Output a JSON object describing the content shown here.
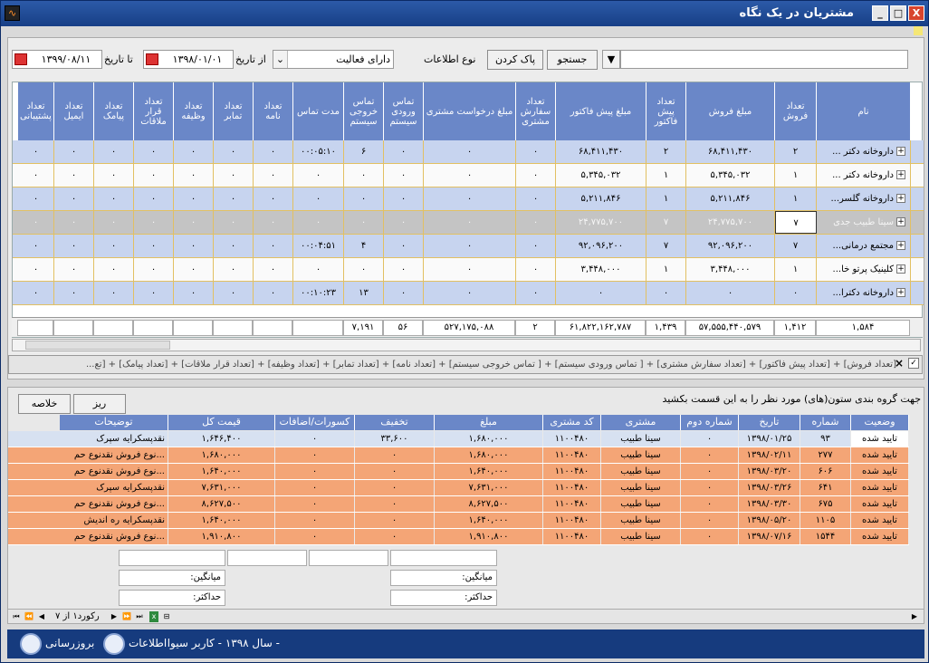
{
  "window": {
    "title": "مشتریان در یک نگاه",
    "min": "_",
    "max": "□",
    "close": "X"
  },
  "toolbar": {
    "search_btn": "جستجو",
    "clear_btn": "پاک کردن",
    "info_type_label": "نوع اطلاعات",
    "info_type_value": "دارای فعالیت",
    "from_label": "از تاریخ",
    "from_value": "۱۳۹۸/۰۱/۰۱",
    "to_label": "تا تاریخ",
    "to_value": "۱۳۹۹/۰۸/۱۱"
  },
  "grid": {
    "headers": [
      "نام",
      "تعداد فروش",
      "مبلغ فروش",
      "تعداد پیش فاکتور",
      "مبلغ پیش فاکتور",
      "تعداد سفارش مشتری",
      "مبلغ درخواست مشتری",
      "تماس ورودی سیستم",
      "تماس خروجی سیستم",
      "مدت تماس",
      "تعداد نامه",
      "تعداد تمابر",
      "تعداد وظیفه",
      "تعداد قرار ملاقات",
      "تعداد پیامک",
      "تعداد ایمیل",
      "تعداد پشتیبانی"
    ],
    "rows": [
      [
        "داروخانه دکتر ...",
        "۲",
        "۶۸,۴۱۱,۴۳۰",
        "۲",
        "۶۸,۴۱۱,۴۳۰",
        "۰",
        "۰",
        "۰",
        "۶",
        "۰۰:۰۵:۱۰",
        "۰",
        "۰",
        "۰",
        "۰",
        "۰",
        "۰",
        "۰"
      ],
      [
        "داروخانه دکتر ...",
        "۱",
        "۵,۳۴۵,۰۳۲",
        "۱",
        "۵,۳۴۵,۰۳۲",
        "۰",
        "۰",
        "۰",
        "۰",
        "۰",
        "۰",
        "۰",
        "۰",
        "۰",
        "۰",
        "۰",
        "۰"
      ],
      [
        "داروخانه گلسر...",
        "۱",
        "۵,۲۱۱,۸۴۶",
        "۱",
        "۵,۲۱۱,۸۴۶",
        "۰",
        "۰",
        "۰",
        "۰",
        "۰",
        "۰",
        "۰",
        "۰",
        "۰",
        "۰",
        "۰",
        "۰"
      ],
      [
        "سینا طبیب جدی",
        "۷",
        "۲۴,۷۷۵,۷۰۰",
        "۷",
        "۲۴,۷۷۵,۷۰۰",
        "۰",
        "۰",
        "۰",
        "۰",
        "۰",
        "۰",
        "۰",
        "۰",
        "۰",
        "۰",
        "۰",
        "۰"
      ],
      [
        "مجتمع درمانی...",
        "۷",
        "۹۲,۰۹۶,۲۰۰",
        "۷",
        "۹۲,۰۹۶,۲۰۰",
        "۰",
        "۰",
        "۰",
        "۴",
        "۰۰:۰۴:۵۱",
        "۰",
        "۰",
        "۰",
        "۰",
        "۰",
        "۰",
        "۰"
      ],
      [
        "کلینیک پرتو خا...",
        "۱",
        "۳,۴۴۸,۰۰۰",
        "۱",
        "۳,۴۴۸,۰۰۰",
        "۰",
        "۰",
        "۰",
        "۰",
        "۰",
        "۰",
        "۰",
        "۰",
        "۰",
        "۰",
        "۰",
        "۰"
      ],
      [
        "داروخانه دکترا...",
        "۰",
        "۰",
        "۰",
        "۰",
        "۰",
        "۰",
        "۰",
        "۱۳",
        "۰۰:۱۰:۲۳",
        "۰",
        "۰",
        "۰",
        "۰",
        "۰",
        "۰",
        "۰"
      ]
    ],
    "totals": [
      "۱,۵۸۴",
      "۱,۴۱۲",
      "۵۷,۵۵۵,۴۴۰,۵۷۹",
      "۱,۴۳۹",
      "۶۱,۸۲۲,۱۶۲,۷۸۷",
      "۲",
      "۵۲۷,۱۷۵,۰۸۸",
      "۵۶",
      "۷,۱۹۱"
    ]
  },
  "filter": "[تعداد فروش] + [تعداد پیش فاکتور] + [تعداد سفارش مشتری] + [ تماس ورودی سیستم] + [ تماس خروجی سیستم] + [تعداد نامه] + [تعداد تمابر] + [تعداد وظیفه] + [تعداد قرار ملاقات] + [تعداد پیامک] + [تع...",
  "detail": {
    "group_hint": "جهت گروه بندی ستون(های) مورد نظر را به این قسمت بکشید",
    "detail_btn": "ریز",
    "summary_btn": "خلاصه",
    "headers": [
      "وضعیت",
      "شماره",
      "تاریخ",
      "شماره دوم",
      "مشتری",
      "کد مشتری",
      "مبلغ",
      "تخفیف",
      "کسورات/اضافات",
      "قیمت کل",
      "توضیحات"
    ],
    "rows": [
      [
        "تایید شده",
        "۹۳",
        "۱۳۹۸/۰۱/۲۵",
        "۰",
        "سینا طبیب",
        "۱۱۰۰۴۸۰",
        "۱,۶۸۰,۰۰۰",
        "۳۳,۶۰۰",
        "۰",
        "۱,۶۴۶,۴۰۰",
        "نقدپسکرایه سپرک"
      ],
      [
        "تایید شده",
        "۲۷۷",
        "۱۳۹۸/۰۲/۱۱",
        "۰",
        "سینا طبیب",
        "۱۱۰۰۴۸۰",
        "۱,۶۸۰,۰۰۰",
        "۰",
        "۰",
        "۱,۶۸۰,۰۰۰",
        "نوع فروش نقدنوع حم..."
      ],
      [
        "تایید شده",
        "۶۰۶",
        "۱۳۹۸/۰۳/۲۰",
        "۰",
        "سینا طبیب",
        "۱۱۰۰۴۸۰",
        "۱,۶۴۰,۰۰۰",
        "۰",
        "۰",
        "۱,۶۴۰,۰۰۰",
        "نوع فروش نقدنوع حم..."
      ],
      [
        "تایید شده",
        "۶۴۱",
        "۱۳۹۸/۰۳/۲۶",
        "۰",
        "سینا طبیب",
        "۱۱۰۰۴۸۰",
        "۷,۶۳۱,۰۰۰",
        "۰",
        "۰",
        "۷,۶۳۱,۰۰۰",
        "نقدپسکرایه سپرک"
      ],
      [
        "تایید شده",
        "۶۷۵",
        "۱۳۹۸/۰۳/۳۰",
        "۰",
        "سینا طبیب",
        "۱۱۰۰۴۸۰",
        "۸,۶۲۷,۵۰۰",
        "۰",
        "۰",
        "۸,۶۲۷,۵۰۰",
        "نوع فروش نقدنوع حم..."
      ],
      [
        "تایید شده",
        "۱۱۰۵",
        "۱۳۹۸/۰۵/۲۰",
        "۰",
        "سینا طبیب",
        "۱۱۰۰۴۸۰",
        "۱,۶۴۰,۰۰۰",
        "۰",
        "۰",
        "۱,۶۴۰,۰۰۰",
        "نقدپسکرایه ره اندیش"
      ],
      [
        "تایید شده",
        "۱۵۴۴",
        "۱۳۹۸/۰۷/۱۶",
        "۰",
        "سینا طبیب",
        "۱۱۰۰۴۸۰",
        "۱,۹۱۰,۸۰۰",
        "۰",
        "۰",
        "۱,۹۱۰,۸۰۰",
        "نوع فروش نقدنوع حم..."
      ]
    ],
    "avg_label": "میانگین:",
    "max_label": "حداکثر:",
    "nav_text": "رکورد۱ از ۷"
  },
  "status": {
    "text": "- سال ۱۳۹۸ - کاربر سیوا",
    "info": "اطلاعات",
    "update": "بروزرسانی"
  },
  "colors": {
    "header": "#6a87c8",
    "row_blue": "#c7d4ef",
    "row_selected": "#c4c4c4",
    "row_orange": "#f4a576",
    "row_first": "#d7e1f1"
  }
}
